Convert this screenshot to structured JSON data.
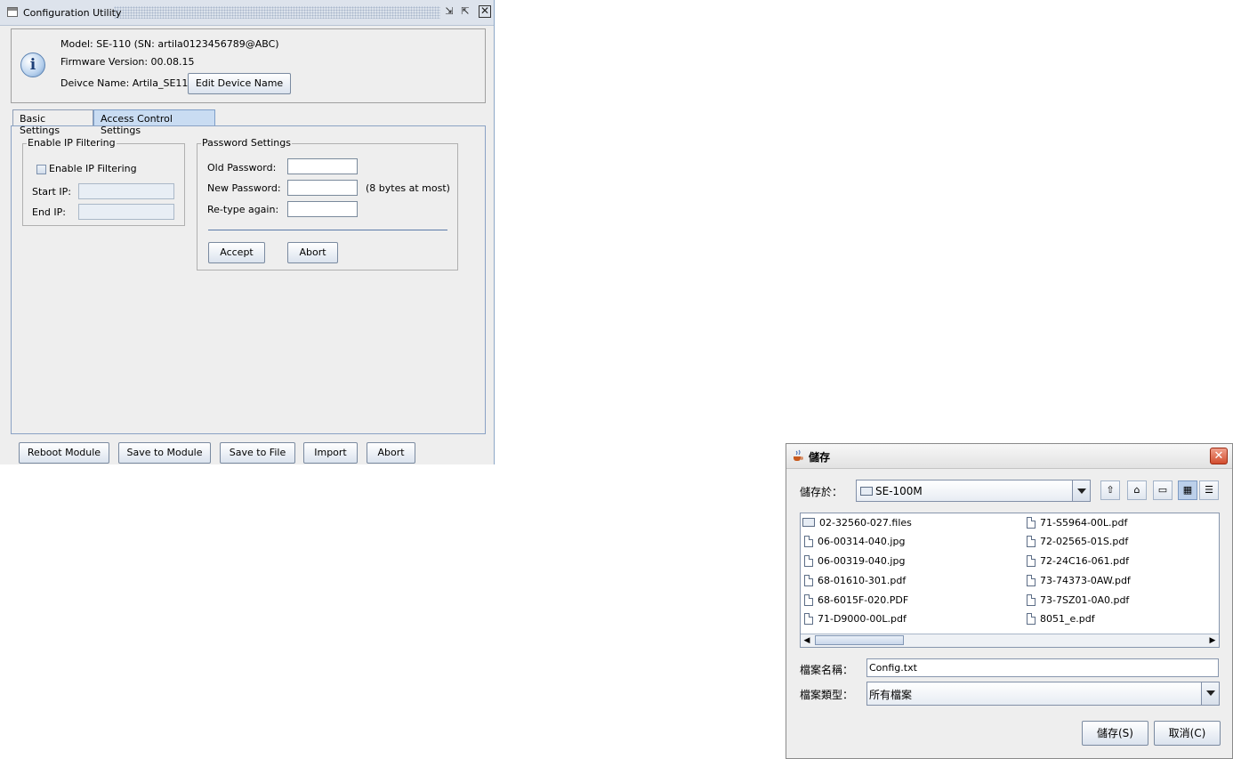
{
  "config_window": {
    "title": "Configuration Utility",
    "titlebar_buttons": {
      "minimize": "⇲",
      "maximize": "⇱",
      "close": "✕"
    },
    "info": {
      "model_line": "Model: SE-110  (SN: artila0123456789@ABC)",
      "firmware_line": "Firmware Version: 00.08.15",
      "device_name_line": "Deivce Name: Artila_SE110",
      "edit_device_name_button": "Edit Device Name"
    },
    "tabs": [
      {
        "label": "Basic Settings",
        "active": false
      },
      {
        "label": "Access Control Settings",
        "active": true
      }
    ],
    "ip_filtering": {
      "group_title": "Enable IP Filtering",
      "checkbox_label": "Enable IP Filtering",
      "checked": false,
      "start_ip_label": "Start IP:",
      "end_ip_label": "End IP:",
      "start_ip_value": "",
      "end_ip_value": ""
    },
    "password": {
      "group_title": "Password Settings",
      "old_label": "Old Password:",
      "new_label": "New Password:",
      "retype_label": "Re-type again:",
      "hint": "(8 bytes at most)",
      "accept_button": "Accept",
      "abort_button": "Abort"
    },
    "bottom_buttons": {
      "reboot": "Reboot Module",
      "save_module": "Save to Module",
      "save_file": "Save to File",
      "import": "Import",
      "abort": "Abort"
    }
  },
  "save_dialog": {
    "title": "儲存",
    "close": "✕",
    "save_in_label": "儲存於：",
    "save_in_value": "SE-100M",
    "toolbar_icons": [
      "up-folder-icon",
      "home-icon",
      "new-folder-icon",
      "list-view-icon",
      "details-view-icon"
    ],
    "files_left": [
      {
        "name": "02-32560-027.files",
        "type": "folder"
      },
      {
        "name": "06-00314-040.jpg",
        "type": "file"
      },
      {
        "name": "06-00319-040.jpg",
        "type": "file"
      },
      {
        "name": "68-01610-301.pdf",
        "type": "file"
      },
      {
        "name": "68-6015F-020.PDF",
        "type": "file"
      },
      {
        "name": "71-D9000-00L.pdf",
        "type": "file"
      }
    ],
    "files_right": [
      {
        "name": "71-S5964-00L.pdf",
        "type": "file"
      },
      {
        "name": "72-02565-01S.pdf",
        "type": "file"
      },
      {
        "name": "72-24C16-061.pdf",
        "type": "file"
      },
      {
        "name": "73-74373-0AW.pdf",
        "type": "file"
      },
      {
        "name": "73-7SZ01-0A0.pdf",
        "type": "file"
      },
      {
        "name": "8051_e.pdf",
        "type": "file"
      }
    ],
    "filename_label": "檔案名稱：",
    "filename_value": "Config.txt",
    "filetype_label": "檔案類型：",
    "filetype_value": "所有檔案",
    "save_button": "儲存(S)",
    "cancel_button": "取消(C)"
  }
}
